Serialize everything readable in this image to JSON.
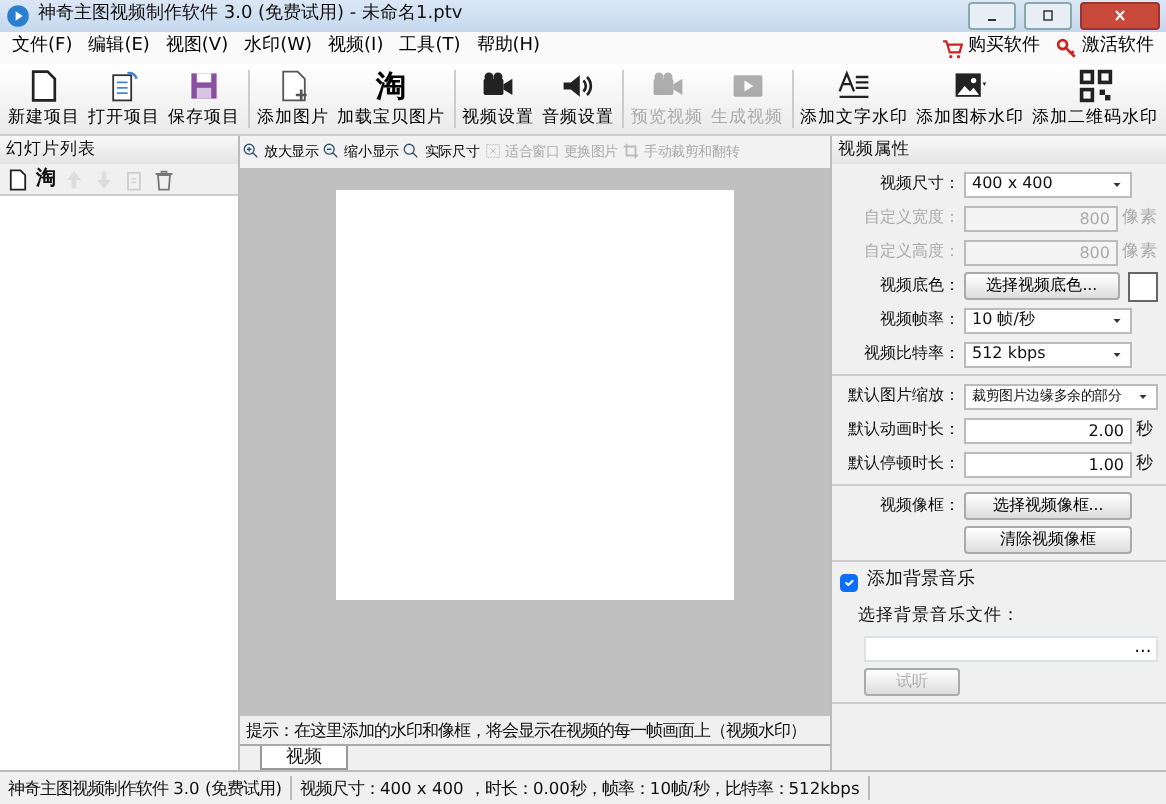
{
  "window": {
    "title": "神奇主图视频制作软件 3.0 (免费试用) - 未命名1.ptv"
  },
  "menu": [
    "文件(F)",
    "编辑(E)",
    "视图(V)",
    "水印(W)",
    "视频(I)",
    "工具(T)",
    "帮助(H)"
  ],
  "menu_right": [
    {
      "label": "购买软件",
      "kind": "cart"
    },
    {
      "label": "激活软件",
      "kind": "key"
    }
  ],
  "toolbar": [
    {
      "label": "新建项目",
      "kind": "doc",
      "disabled": false
    },
    {
      "label": "打开项目",
      "kind": "open",
      "disabled": false
    },
    {
      "label": "保存项目",
      "kind": "save",
      "disabled": false
    },
    {
      "label": "添加图片",
      "kind": "addpage",
      "disabled": false,
      "group_start": true
    },
    {
      "label": "加载宝贝图片",
      "kind": "glyph",
      "glyph": "淘",
      "disabled": false
    },
    {
      "label": "视频设置",
      "kind": "camera",
      "disabled": false,
      "group_start": true
    },
    {
      "label": "音频设置",
      "kind": "speaker",
      "disabled": false
    },
    {
      "label": "预览视频",
      "kind": "camera",
      "disabled": true,
      "group_start": true
    },
    {
      "label": "生成视频",
      "kind": "play",
      "disabled": true
    },
    {
      "label": "添加文字水印",
      "kind": "text",
      "disabled": false,
      "group_start": true
    },
    {
      "label": "添加图标水印",
      "kind": "image",
      "disabled": false
    },
    {
      "label": "添加二维码水印",
      "kind": "qr",
      "disabled": false
    }
  ],
  "slide_list": {
    "title": "幻灯片列表",
    "tools": [
      {
        "kind": "doc",
        "disabled": false
      },
      {
        "kind": "glyph",
        "glyph": "淘",
        "disabled": false
      },
      {
        "kind": "up",
        "disabled": true
      },
      {
        "kind": "down",
        "disabled": true
      },
      {
        "kind": "clip",
        "disabled": true
      },
      {
        "kind": "trash",
        "disabled": false
      }
    ]
  },
  "view_toolbar": [
    {
      "label": "放大显示",
      "kind": "zoomin",
      "disabled": false
    },
    {
      "label": "缩小显示",
      "kind": "zoomout",
      "disabled": false
    },
    {
      "label": "实际尺寸",
      "kind": "zoom",
      "disabled": false
    },
    {
      "label": "适合窗口",
      "kind": "fit",
      "disabled": true
    },
    {
      "label": "更换图片",
      "kind": "none",
      "disabled": true
    },
    {
      "label": "手动裁剪和翻转",
      "kind": "crop",
      "disabled": true
    }
  ],
  "hint": "提示：在这里添加的水印和像框，将会显示在视频的每一帧画面上（视频水印）",
  "tabs": [
    {
      "label": "视频",
      "selected": true
    }
  ],
  "properties": {
    "title": "视频属性",
    "sections": [
      [
        {
          "label": "视频尺寸：",
          "kind": "select",
          "value": "400 x 400",
          "disabled": false
        },
        {
          "label": "自定义宽度：",
          "kind": "spin",
          "value": "800",
          "unit": "像素",
          "disabled": true
        },
        {
          "label": "自定义高度：",
          "kind": "spin",
          "value": "800",
          "unit": "像素",
          "disabled": true
        },
        {
          "label": "视频底色：",
          "kind": "color",
          "button": "选择视频底色...",
          "disabled": false
        },
        {
          "label": "视频帧率：",
          "kind": "select",
          "value": "10 帧/秒",
          "disabled": false
        },
        {
          "label": "视频比特率：",
          "kind": "select",
          "value": "512 kbps",
          "disabled": false
        }
      ],
      [
        {
          "label": "默认图片缩放：",
          "kind": "select",
          "value": "裁剪图片边缘多余的部分",
          "disabled": false
        },
        {
          "label": "默认动画时长：",
          "kind": "spin",
          "value": "2.00",
          "unit": "秒",
          "disabled": false
        },
        {
          "label": "默认停顿时长：",
          "kind": "spin",
          "value": "1.00",
          "unit": "秒",
          "disabled": false
        }
      ],
      [
        {
          "label": "视频像框：",
          "kind": "button",
          "button": "选择视频像框...",
          "disabled": false
        },
        {
          "kind": "button",
          "button": "清除视频像框",
          "disabled": false
        }
      ]
    ],
    "music": {
      "label": "添加背景音乐",
      "checked": true,
      "file_label": "选择背景音乐文件：",
      "browse": "...",
      "preview": "试听",
      "preview_disabled": true
    }
  },
  "status_bar": [
    "神奇主图视频制作软件 3.0 (免费试用)",
    "视频尺寸：400 x 400 ，时长：0.00秒，帧率：10帧/秒，比特率：512kbps"
  ]
}
